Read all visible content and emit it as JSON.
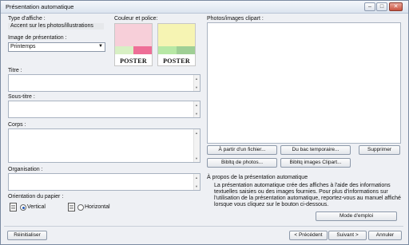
{
  "window": {
    "title": "Présentation automatique",
    "min": "–",
    "max": "□",
    "close": "✕"
  },
  "poster_type": {
    "label": "Type d'affiche :",
    "value": "Accent sur les photos/illustrations"
  },
  "image": {
    "label": "Image de présentation :",
    "value": "Printemps"
  },
  "colors": {
    "label": "Couleur et police:",
    "swatches": [
      {
        "main": "#f7cfd9",
        "stripe_left": "#d8f0c4",
        "stripe_right": "#ee6f97",
        "poster": "POSTER"
      },
      {
        "main": "#f6f4b3",
        "stripe_left": "#b7e8a5",
        "stripe_right": "#9fcf95",
        "poster": "POSTER"
      }
    ]
  },
  "fields": {
    "titre": "Titre :",
    "sous_titre": "Sous-titre :",
    "corps": "Corps :",
    "organisation": "Organisation :"
  },
  "orientation": {
    "label": "Orientation du papier :",
    "vertical": "Vertical",
    "horizontal": "Horizontal"
  },
  "photos": {
    "label": "Photos/images clipart :",
    "from_file": "À partir d'un fichier...",
    "from_temp": "Du bac temporaire...",
    "delete": "Supprimer",
    "photo_lib": "Bibltq de photos...",
    "clipart_lib": "Bibltq images Clipart..."
  },
  "about": {
    "title": "À propos de la présentation automatique",
    "lines": [
      "La présentation automatique crée des affiches à l'aide des informations",
      "textuelles saisies ou des images fournies. Pour plus d'informations sur",
      "l'utilisation de la présentation automatique, reportez-vous au manuel affiché",
      "lorsque vous cliquez sur le bouton ci-dessous."
    ],
    "manual_button": "Mode d'emploi"
  },
  "footer": {
    "reset": "Réinitialiser",
    "prev": "< Précédent",
    "next": "Suivant >",
    "cancel": "Annuler"
  }
}
